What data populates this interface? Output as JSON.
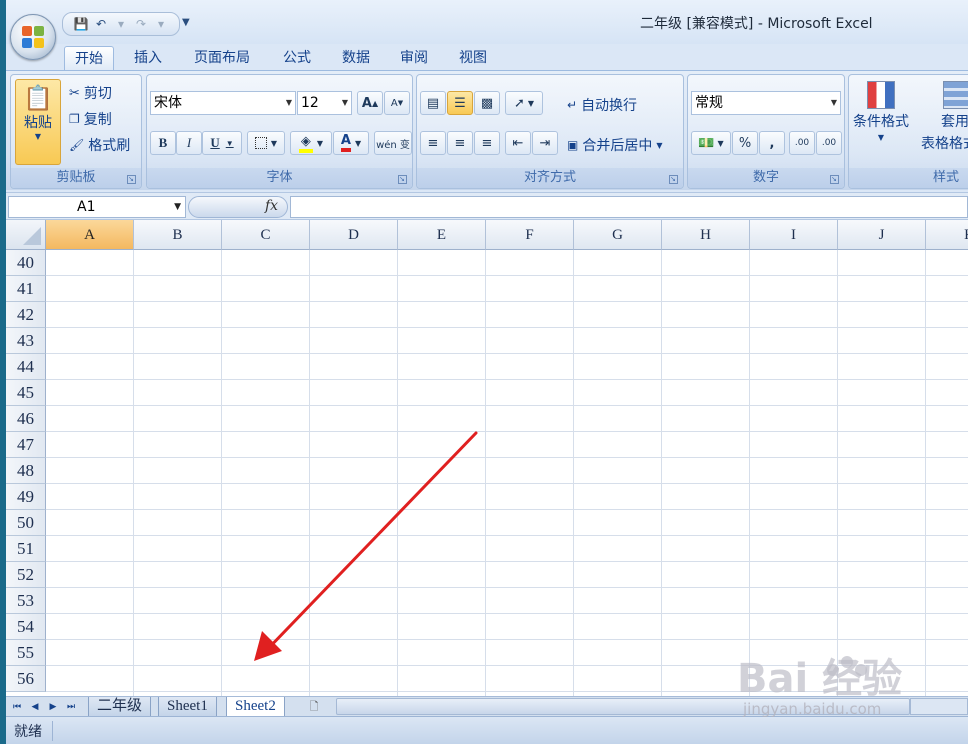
{
  "window": {
    "title": "二年级  [兼容模式] - Microsoft Excel"
  },
  "quick_access": [
    "save-icon",
    "undo-icon",
    "redo-icon",
    "customize-icon"
  ],
  "tabs": [
    "开始",
    "插入",
    "页面布局",
    "公式",
    "数据",
    "审阅",
    "视图"
  ],
  "ribbon": {
    "clipboard": {
      "label": "剪贴板",
      "paste": "粘贴",
      "cut": "剪切",
      "copy": "复制",
      "format_painter": "格式刷"
    },
    "font": {
      "label": "字体",
      "font_name": "宋体",
      "font_size": "12",
      "bold": "B",
      "italic": "I",
      "underline": "U",
      "font_color": "A",
      "phonetic": "wén 变",
      "grow": "A",
      "shrink": "A"
    },
    "alignment": {
      "label": "对齐方式",
      "wrap_text": "自动换行",
      "merge_center": "合并后居中"
    },
    "number": {
      "label": "数字",
      "format": "常规",
      "percent": "%",
      "comma": ",",
      "increase_decimal": ".00",
      "decrease_decimal": ".00"
    },
    "styles": {
      "label": "样式",
      "conditional_format": "条件格式",
      "table_format": "套用",
      "table_format_2": "表格格式"
    }
  },
  "formula_bar": {
    "name_box": "A1",
    "fx": "fx",
    "formula": ""
  },
  "grid": {
    "columns": [
      "A",
      "B",
      "C",
      "D",
      "E",
      "F",
      "G",
      "H",
      "I",
      "J",
      "K"
    ],
    "selected_column": "A",
    "rows": [
      "40",
      "41",
      "42",
      "43",
      "44",
      "45",
      "46",
      "47",
      "48",
      "49",
      "50",
      "51",
      "52",
      "53",
      "54",
      "55",
      "56"
    ]
  },
  "sheets": {
    "tabs": [
      "二年级",
      "Sheet1",
      "Sheet2"
    ],
    "active": "Sheet2"
  },
  "status": {
    "text": "就绪"
  },
  "watermark": {
    "brand": "Bai 经验",
    "url": "jingyan.baidu.com"
  },
  "colors": {
    "accent": "#15428b",
    "arrow": "#e02020",
    "selected_header": "#f4b860"
  }
}
